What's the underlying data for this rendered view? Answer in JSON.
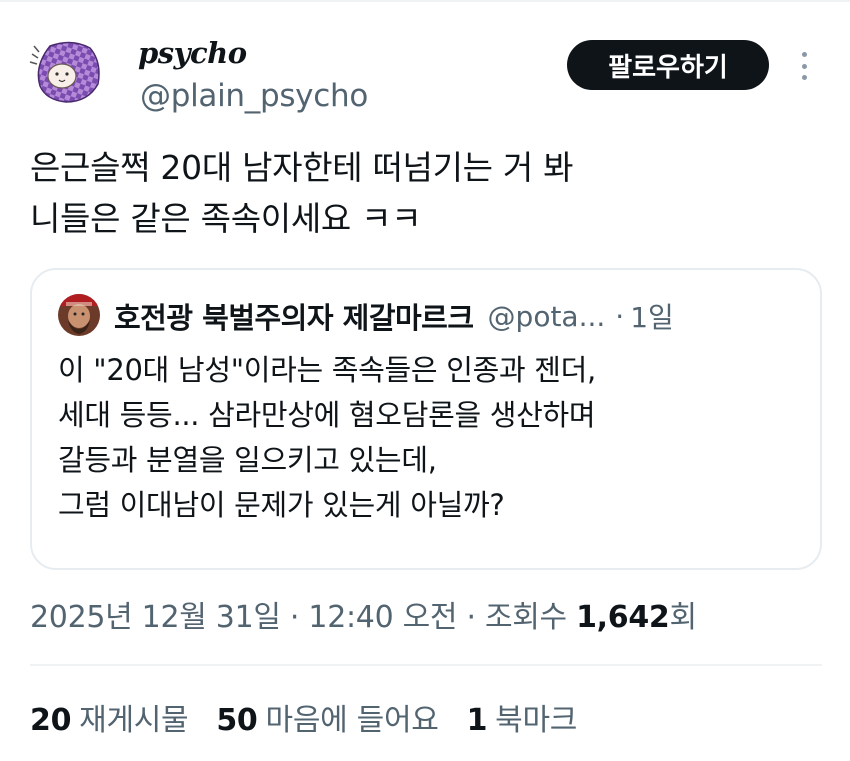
{
  "author": {
    "display_name": "psycho",
    "handle": "@plain_psycho"
  },
  "follow_button_label": "팔로우하기",
  "tweet_lines": [
    "은근슬쩍 20대 남자한테 떠넘기는 거 봐",
    "니들은 같은 족속이세요 ㅋㅋ"
  ],
  "quoted_tweet": {
    "display_name": "호전광 북벌주의자 제갈마르크",
    "handle": "@pota...",
    "separator": "·",
    "time": "1일",
    "lines": [
      "이 \"20대 남성\"이라는 족속들은 인종과 젠더,",
      "세대 등등... 삼라만상에 혐오담론을 생산하며",
      "갈등과 분열을 일으키고 있는데,",
      "그럼 이대남이 문제가 있는게 아닐까?"
    ]
  },
  "meta": {
    "date": "2025년 12월 31일",
    "sep1": "·",
    "time": "12:40 오전",
    "sep2": "·",
    "views_label": "조회수",
    "views_count": "1,642",
    "views_suffix": "회"
  },
  "stats": [
    {
      "count": "20",
      "label": "재게시물"
    },
    {
      "count": "50",
      "label": "마음에 들어요"
    },
    {
      "count": "1",
      "label": "북마크"
    }
  ],
  "icons": {
    "more": "more-vertical-icon",
    "avatar": "checkered-cloth-avatar",
    "quoted_avatar": "bearded-man-avatar"
  },
  "colors": {
    "text": "#0f1419",
    "secondary": "#536471",
    "border": "#e6ecf0",
    "button_bg": "#0f1419"
  }
}
